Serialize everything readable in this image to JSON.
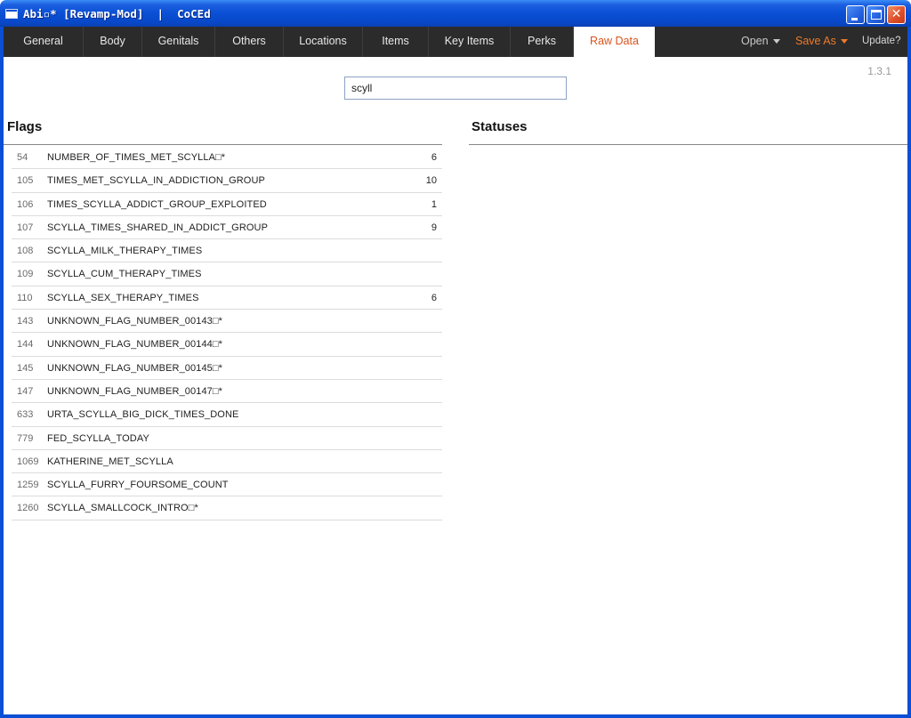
{
  "window": {
    "title": "Abi▫* [Revamp-Mod]  |  CoCEd",
    "minimize_label": "",
    "maximize_label": "",
    "close_label": "✕"
  },
  "tabs": [
    {
      "label": "General"
    },
    {
      "label": "Body"
    },
    {
      "label": "Genitals"
    },
    {
      "label": "Others"
    },
    {
      "label": "Locations"
    },
    {
      "label": "Items"
    },
    {
      "label": "Key Items"
    },
    {
      "label": "Perks"
    },
    {
      "label": "Raw Data",
      "active": true
    }
  ],
  "menu": {
    "open_label": "Open",
    "save_as_label": "Save As",
    "update_label": "Update?"
  },
  "version": "1.3.1",
  "search": {
    "value": "scyll",
    "placeholder": ""
  },
  "flags": {
    "title": "Flags",
    "rows": [
      {
        "id": "54",
        "name": "NUMBER_OF_TIMES_MET_SCYLLA□*",
        "value": "6"
      },
      {
        "id": "105",
        "name": "TIMES_MET_SCYLLA_IN_ADDICTION_GROUP",
        "value": "10"
      },
      {
        "id": "106",
        "name": "TIMES_SCYLLA_ADDICT_GROUP_EXPLOITED",
        "value": "1"
      },
      {
        "id": "107",
        "name": "SCYLLA_TIMES_SHARED_IN_ADDICT_GROUP",
        "value": "9"
      },
      {
        "id": "108",
        "name": "SCYLLA_MILK_THERAPY_TIMES",
        "value": ""
      },
      {
        "id": "109",
        "name": "SCYLLA_CUM_THERAPY_TIMES",
        "value": ""
      },
      {
        "id": "110",
        "name": "SCYLLA_SEX_THERAPY_TIMES",
        "value": "6"
      },
      {
        "id": "143",
        "name": "UNKNOWN_FLAG_NUMBER_00143□*",
        "value": ""
      },
      {
        "id": "144",
        "name": "UNKNOWN_FLAG_NUMBER_00144□*",
        "value": ""
      },
      {
        "id": "145",
        "name": "UNKNOWN_FLAG_NUMBER_00145□*",
        "value": ""
      },
      {
        "id": "147",
        "name": "UNKNOWN_FLAG_NUMBER_00147□*",
        "value": ""
      },
      {
        "id": "633",
        "name": "URTA_SCYLLA_BIG_DICK_TIMES_DONE",
        "value": ""
      },
      {
        "id": "779",
        "name": "FED_SCYLLA_TODAY",
        "value": ""
      },
      {
        "id": "1069",
        "name": "KATHERINE_MET_SCYLLA",
        "value": ""
      },
      {
        "id": "1259",
        "name": "SCYLLA_FURRY_FOURSOME_COUNT",
        "value": ""
      },
      {
        "id": "1260",
        "name": "SCYLLA_SMALLCOCK_INTRO□*",
        "value": ""
      }
    ]
  },
  "statuses": {
    "title": "Statuses",
    "rows": []
  },
  "colors": {
    "titlebar_blue": "#0a4fd4",
    "tabbar_bg": "#2b2b2b",
    "active_tab_text": "#d9531e",
    "save_as_orange": "#ef7a2a"
  }
}
